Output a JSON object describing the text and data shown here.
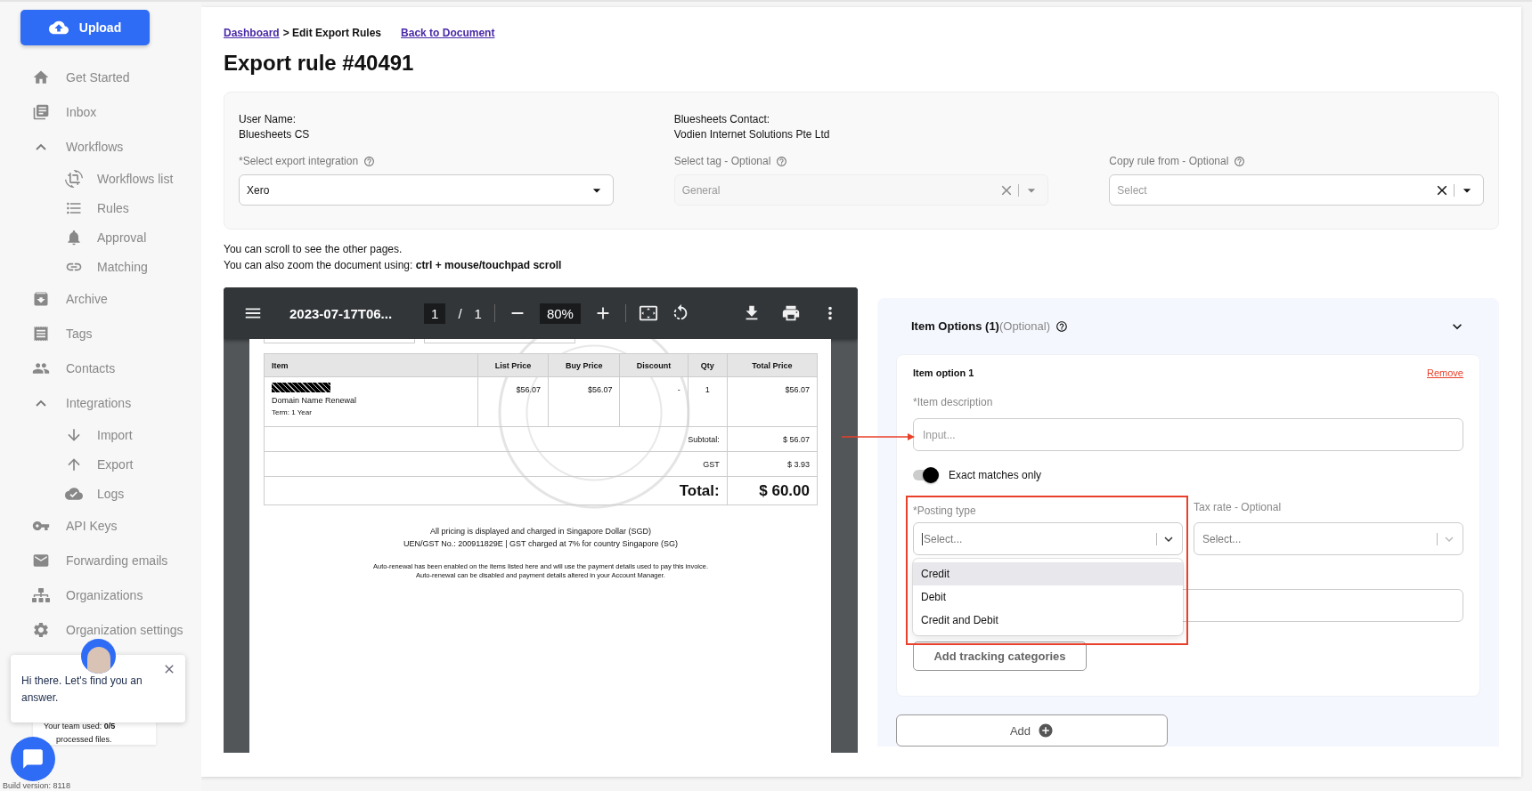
{
  "sidebar": {
    "upload_button": "Upload",
    "items": [
      {
        "label": "Get Started"
      },
      {
        "label": "Inbox"
      },
      {
        "label": "Workflows",
        "expanded": true,
        "children": [
          {
            "label": "Workflows list"
          },
          {
            "label": "Rules"
          },
          {
            "label": "Approval"
          },
          {
            "label": "Matching"
          }
        ]
      },
      {
        "label": "Archive"
      },
      {
        "label": "Tags"
      },
      {
        "label": "Contacts"
      },
      {
        "label": "Integrations",
        "expanded": true,
        "children": [
          {
            "label": "Import"
          },
          {
            "label": "Export"
          },
          {
            "label": "Logs"
          }
        ]
      },
      {
        "label": "API Keys"
      },
      {
        "label": "Forwarding emails"
      },
      {
        "label": "Organizations"
      },
      {
        "label": "Organization settings"
      }
    ]
  },
  "chat": {
    "greeting": "Hi there. Let's find you an answer.",
    "usage_text": "Your team used: **0/5**",
    "usage_note": "processed files."
  },
  "build_version": "Build version: 8118",
  "breadcrumb": {
    "link": "Dashboard",
    "current": "> Edit Export Rules",
    "back_link": "Back to Document"
  },
  "title": "Export rule #40491",
  "info": {
    "user_name_label": "User Name:",
    "user_name": "Bluesheets CS",
    "contact_label": "Bluesheets Contact:",
    "contact": "Vodien Internet Solutions Pte Ltd",
    "selects": [
      {
        "label": "*Select export integration",
        "value": "Xero",
        "disabled": false,
        "clearable": false
      },
      {
        "label": "Select tag - Optional",
        "value": "General",
        "disabled": true,
        "clearable": true
      },
      {
        "label": "Copy rule from - Optional",
        "placeholder": "Select",
        "disabled": false,
        "clearable": true
      }
    ]
  },
  "notes": [
    "You can scroll to see the other pages.",
    "You can also zoom the document using: **ctrl + mouse/touchpad scroll**"
  ],
  "pdf_viewer": {
    "file_name": "2023-07-17T06...",
    "page": "1",
    "page_separator": "/",
    "page_count": "1",
    "zoom": "80%",
    "document": {
      "columns": [
        "Item",
        "List Price",
        "Buy Price",
        "Discount",
        "Qty",
        "Total Price"
      ],
      "rows": [
        {
          "redacted": true,
          "cells": [
            "Domain Name Renewal",
            "$56.07",
            "$56.07",
            "-",
            "1",
            "$56.07"
          ],
          "notes": [
            "Term: 1 Year"
          ]
        }
      ],
      "totals": [
        {
          "label": "Subtotal:",
          "value": "$ 56.07",
          "kind": "normal"
        },
        {
          "label": "GST",
          "value": "$ 3.93",
          "kind": "normal"
        },
        {
          "label": "Total:",
          "value": "$ 60.00",
          "kind": "grand"
        }
      ],
      "footer": [
        "All pricing is displayed and charged in Singapore Dollar (SGD)",
        "UEN/GST No.: 200911829E | GST charged at 7% for country Singapore (SG)"
      ],
      "fine_print": [
        "Auto-renewal has been enabled on the items listed here and will use the payment details used to pay this invoice.",
        "Auto-renewal can be disabled and payment details altered in your Account Manager."
      ]
    }
  },
  "item_options": {
    "title": "Item Options (1)",
    "optional": "(Optional)",
    "expanded": true,
    "options": [
      {
        "title": "Item option 1",
        "remove": "Remove",
        "description_label": "*Item description",
        "description_placeholder": "Input...",
        "exact_match": {
          "label": "Exact matches only",
          "on": true
        },
        "posting_type": {
          "label": "*Posting type",
          "placeholder": "Select...",
          "open": true,
          "options": [
            {
              "label": "Credit",
              "highlighted": true
            },
            {
              "label": "Debit",
              "highlighted": false
            },
            {
              "label": "Credit and Debit",
              "highlighted": false
            }
          ]
        },
        "tax_rate": {
          "label": "Tax rate - Optional",
          "placeholder": "Select..."
        },
        "tracking_button": "Add tracking categories"
      }
    ],
    "add_button": "Add"
  },
  "annotations": [
    {
      "kind": "arrow"
    },
    {
      "kind": "highlight"
    }
  ]
}
